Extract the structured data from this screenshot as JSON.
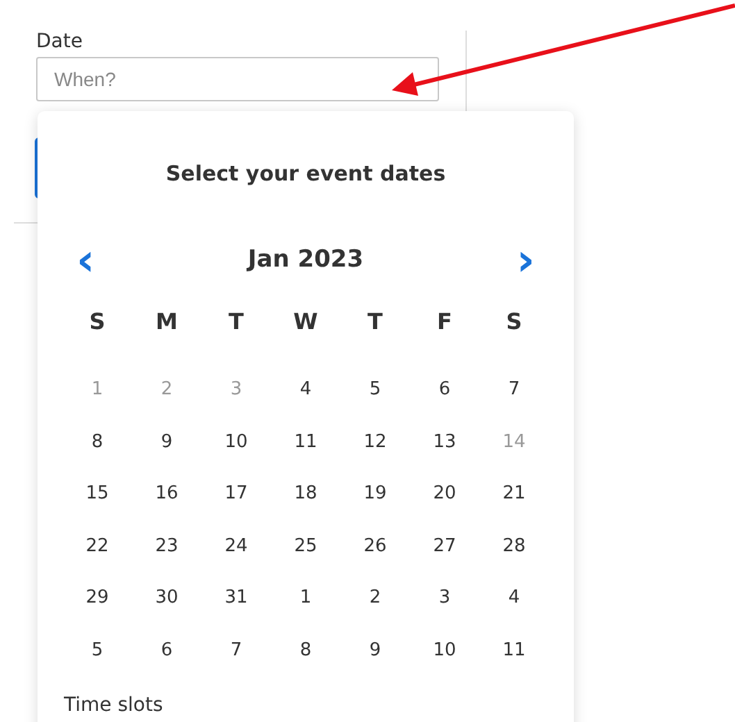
{
  "date_field": {
    "label": "Date",
    "placeholder": "When?"
  },
  "calendar": {
    "title": "Select your event dates",
    "prev": "‹",
    "month": "Jan 2023",
    "next": "›",
    "weekdays": [
      "S",
      "M",
      "T",
      "W",
      "T",
      "F",
      "S"
    ],
    "weeks": [
      [
        {
          "day": "1",
          "muted": true
        },
        {
          "day": "2",
          "muted": true
        },
        {
          "day": "3",
          "muted": true
        },
        {
          "day": "4",
          "muted": false
        },
        {
          "day": "5",
          "muted": false
        },
        {
          "day": "6",
          "muted": false
        },
        {
          "day": "7",
          "muted": false
        }
      ],
      [
        {
          "day": "8",
          "muted": false
        },
        {
          "day": "9",
          "muted": false
        },
        {
          "day": "10",
          "muted": false
        },
        {
          "day": "11",
          "muted": false
        },
        {
          "day": "12",
          "muted": false
        },
        {
          "day": "13",
          "muted": false
        },
        {
          "day": "14",
          "muted": true
        }
      ],
      [
        {
          "day": "15",
          "muted": false
        },
        {
          "day": "16",
          "muted": false
        },
        {
          "day": "17",
          "muted": false
        },
        {
          "day": "18",
          "muted": false
        },
        {
          "day": "19",
          "muted": false
        },
        {
          "day": "20",
          "muted": false
        },
        {
          "day": "21",
          "muted": false
        }
      ],
      [
        {
          "day": "22",
          "muted": false
        },
        {
          "day": "23",
          "muted": false
        },
        {
          "day": "24",
          "muted": false
        },
        {
          "day": "25",
          "muted": false
        },
        {
          "day": "26",
          "muted": false
        },
        {
          "day": "27",
          "muted": false
        },
        {
          "day": "28",
          "muted": false
        }
      ],
      [
        {
          "day": "29",
          "muted": false
        },
        {
          "day": "30",
          "muted": false
        },
        {
          "day": "31",
          "muted": false
        },
        {
          "day": "1",
          "muted": false
        },
        {
          "day": "2",
          "muted": false
        },
        {
          "day": "3",
          "muted": false
        },
        {
          "day": "4",
          "muted": false
        }
      ],
      [
        {
          "day": "5",
          "muted": false
        },
        {
          "day": "6",
          "muted": false
        },
        {
          "day": "7",
          "muted": false
        },
        {
          "day": "8",
          "muted": false
        },
        {
          "day": "9",
          "muted": false
        },
        {
          "day": "10",
          "muted": false
        },
        {
          "day": "11",
          "muted": false
        }
      ]
    ],
    "section_label": "Time slots"
  }
}
